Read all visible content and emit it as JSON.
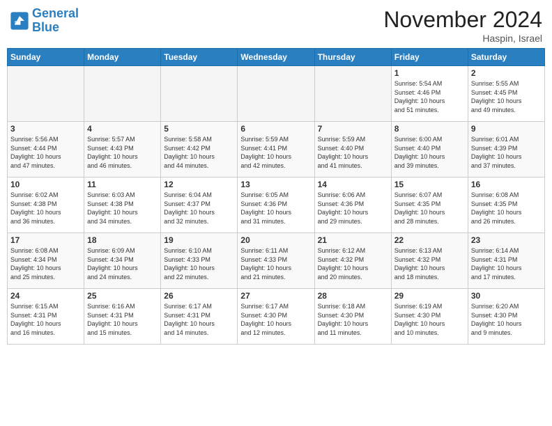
{
  "logo": {
    "line1": "General",
    "line2": "Blue"
  },
  "title": "November 2024",
  "location": "Haspin, Israel",
  "weekdays": [
    "Sunday",
    "Monday",
    "Tuesday",
    "Wednesday",
    "Thursday",
    "Friday",
    "Saturday"
  ],
  "weeks": [
    [
      {
        "day": "",
        "info": ""
      },
      {
        "day": "",
        "info": ""
      },
      {
        "day": "",
        "info": ""
      },
      {
        "day": "",
        "info": ""
      },
      {
        "day": "",
        "info": ""
      },
      {
        "day": "1",
        "info": "Sunrise: 5:54 AM\nSunset: 4:46 PM\nDaylight: 10 hours\nand 51 minutes."
      },
      {
        "day": "2",
        "info": "Sunrise: 5:55 AM\nSunset: 4:45 PM\nDaylight: 10 hours\nand 49 minutes."
      }
    ],
    [
      {
        "day": "3",
        "info": "Sunrise: 5:56 AM\nSunset: 4:44 PM\nDaylight: 10 hours\nand 47 minutes."
      },
      {
        "day": "4",
        "info": "Sunrise: 5:57 AM\nSunset: 4:43 PM\nDaylight: 10 hours\nand 46 minutes."
      },
      {
        "day": "5",
        "info": "Sunrise: 5:58 AM\nSunset: 4:42 PM\nDaylight: 10 hours\nand 44 minutes."
      },
      {
        "day": "6",
        "info": "Sunrise: 5:59 AM\nSunset: 4:41 PM\nDaylight: 10 hours\nand 42 minutes."
      },
      {
        "day": "7",
        "info": "Sunrise: 5:59 AM\nSunset: 4:40 PM\nDaylight: 10 hours\nand 41 minutes."
      },
      {
        "day": "8",
        "info": "Sunrise: 6:00 AM\nSunset: 4:40 PM\nDaylight: 10 hours\nand 39 minutes."
      },
      {
        "day": "9",
        "info": "Sunrise: 6:01 AM\nSunset: 4:39 PM\nDaylight: 10 hours\nand 37 minutes."
      }
    ],
    [
      {
        "day": "10",
        "info": "Sunrise: 6:02 AM\nSunset: 4:38 PM\nDaylight: 10 hours\nand 36 minutes."
      },
      {
        "day": "11",
        "info": "Sunrise: 6:03 AM\nSunset: 4:38 PM\nDaylight: 10 hours\nand 34 minutes."
      },
      {
        "day": "12",
        "info": "Sunrise: 6:04 AM\nSunset: 4:37 PM\nDaylight: 10 hours\nand 32 minutes."
      },
      {
        "day": "13",
        "info": "Sunrise: 6:05 AM\nSunset: 4:36 PM\nDaylight: 10 hours\nand 31 minutes."
      },
      {
        "day": "14",
        "info": "Sunrise: 6:06 AM\nSunset: 4:36 PM\nDaylight: 10 hours\nand 29 minutes."
      },
      {
        "day": "15",
        "info": "Sunrise: 6:07 AM\nSunset: 4:35 PM\nDaylight: 10 hours\nand 28 minutes."
      },
      {
        "day": "16",
        "info": "Sunrise: 6:08 AM\nSunset: 4:35 PM\nDaylight: 10 hours\nand 26 minutes."
      }
    ],
    [
      {
        "day": "17",
        "info": "Sunrise: 6:08 AM\nSunset: 4:34 PM\nDaylight: 10 hours\nand 25 minutes."
      },
      {
        "day": "18",
        "info": "Sunrise: 6:09 AM\nSunset: 4:34 PM\nDaylight: 10 hours\nand 24 minutes."
      },
      {
        "day": "19",
        "info": "Sunrise: 6:10 AM\nSunset: 4:33 PM\nDaylight: 10 hours\nand 22 minutes."
      },
      {
        "day": "20",
        "info": "Sunrise: 6:11 AM\nSunset: 4:33 PM\nDaylight: 10 hours\nand 21 minutes."
      },
      {
        "day": "21",
        "info": "Sunrise: 6:12 AM\nSunset: 4:32 PM\nDaylight: 10 hours\nand 20 minutes."
      },
      {
        "day": "22",
        "info": "Sunrise: 6:13 AM\nSunset: 4:32 PM\nDaylight: 10 hours\nand 18 minutes."
      },
      {
        "day": "23",
        "info": "Sunrise: 6:14 AM\nSunset: 4:31 PM\nDaylight: 10 hours\nand 17 minutes."
      }
    ],
    [
      {
        "day": "24",
        "info": "Sunrise: 6:15 AM\nSunset: 4:31 PM\nDaylight: 10 hours\nand 16 minutes."
      },
      {
        "day": "25",
        "info": "Sunrise: 6:16 AM\nSunset: 4:31 PM\nDaylight: 10 hours\nand 15 minutes."
      },
      {
        "day": "26",
        "info": "Sunrise: 6:17 AM\nSunset: 4:31 PM\nDaylight: 10 hours\nand 14 minutes."
      },
      {
        "day": "27",
        "info": "Sunrise: 6:17 AM\nSunset: 4:30 PM\nDaylight: 10 hours\nand 12 minutes."
      },
      {
        "day": "28",
        "info": "Sunrise: 6:18 AM\nSunset: 4:30 PM\nDaylight: 10 hours\nand 11 minutes."
      },
      {
        "day": "29",
        "info": "Sunrise: 6:19 AM\nSunset: 4:30 PM\nDaylight: 10 hours\nand 10 minutes."
      },
      {
        "day": "30",
        "info": "Sunrise: 6:20 AM\nSunset: 4:30 PM\nDaylight: 10 hours\nand 9 minutes."
      }
    ]
  ]
}
